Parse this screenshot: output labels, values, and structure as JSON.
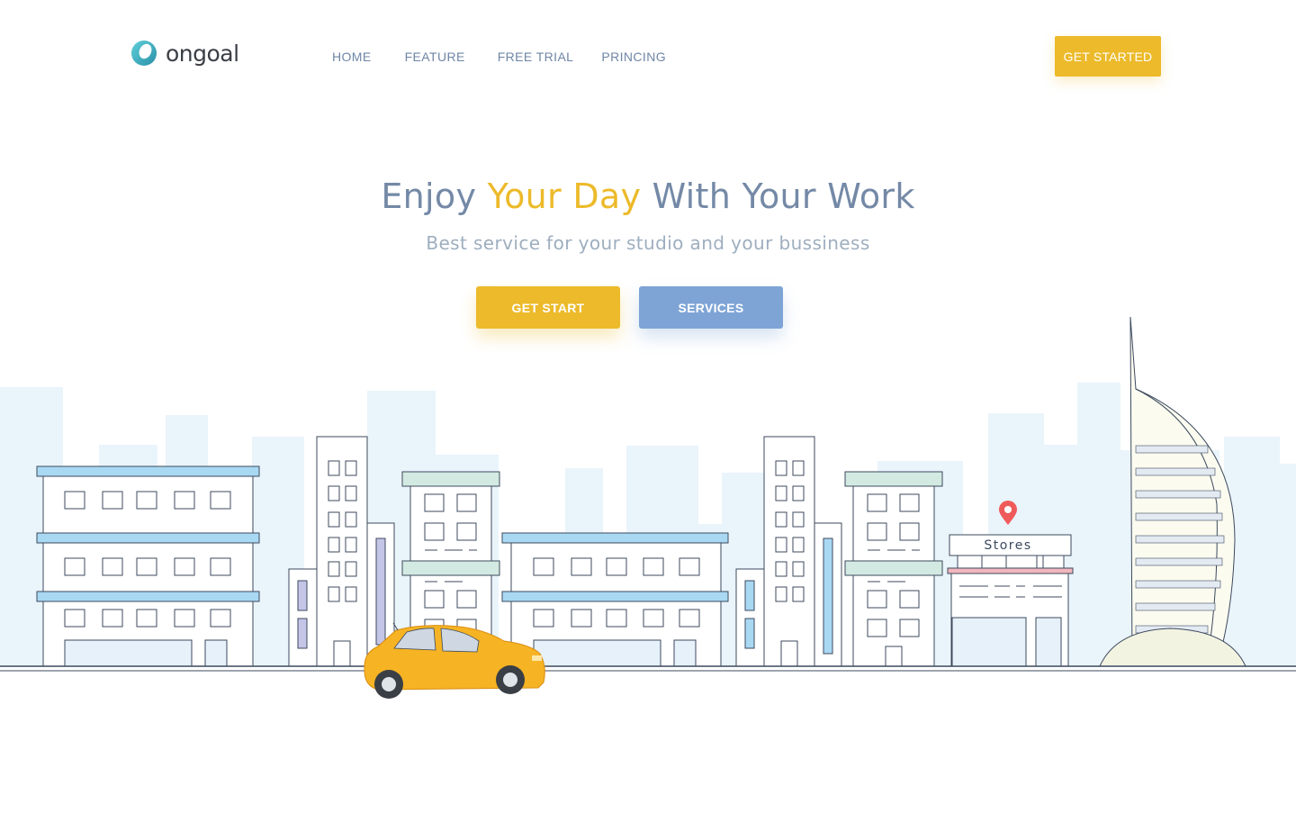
{
  "brand": {
    "name": "ongoal",
    "logo_icon": "circle-swirl-icon"
  },
  "nav": {
    "items": [
      {
        "label": "HOME"
      },
      {
        "label": "FEATURE"
      },
      {
        "label": "FREE TRIAL"
      },
      {
        "label": "PRINCING"
      }
    ]
  },
  "header": {
    "cta_label": "GET STARTED"
  },
  "hero": {
    "title_part1": "Enjoy ",
    "title_highlight": "Your Day",
    "title_part2": " With Your Work",
    "subtitle": "Best service for your studio and your bussiness",
    "primary_button": "GET START",
    "secondary_button": "SERVICES"
  },
  "illustration": {
    "store_sign": "Stores"
  },
  "colors": {
    "accent": "#ecba2a",
    "secondary": "#7ea4d6",
    "text": "#7489a6",
    "muted": "#9eaebf",
    "sky": "#eaf4fb"
  }
}
